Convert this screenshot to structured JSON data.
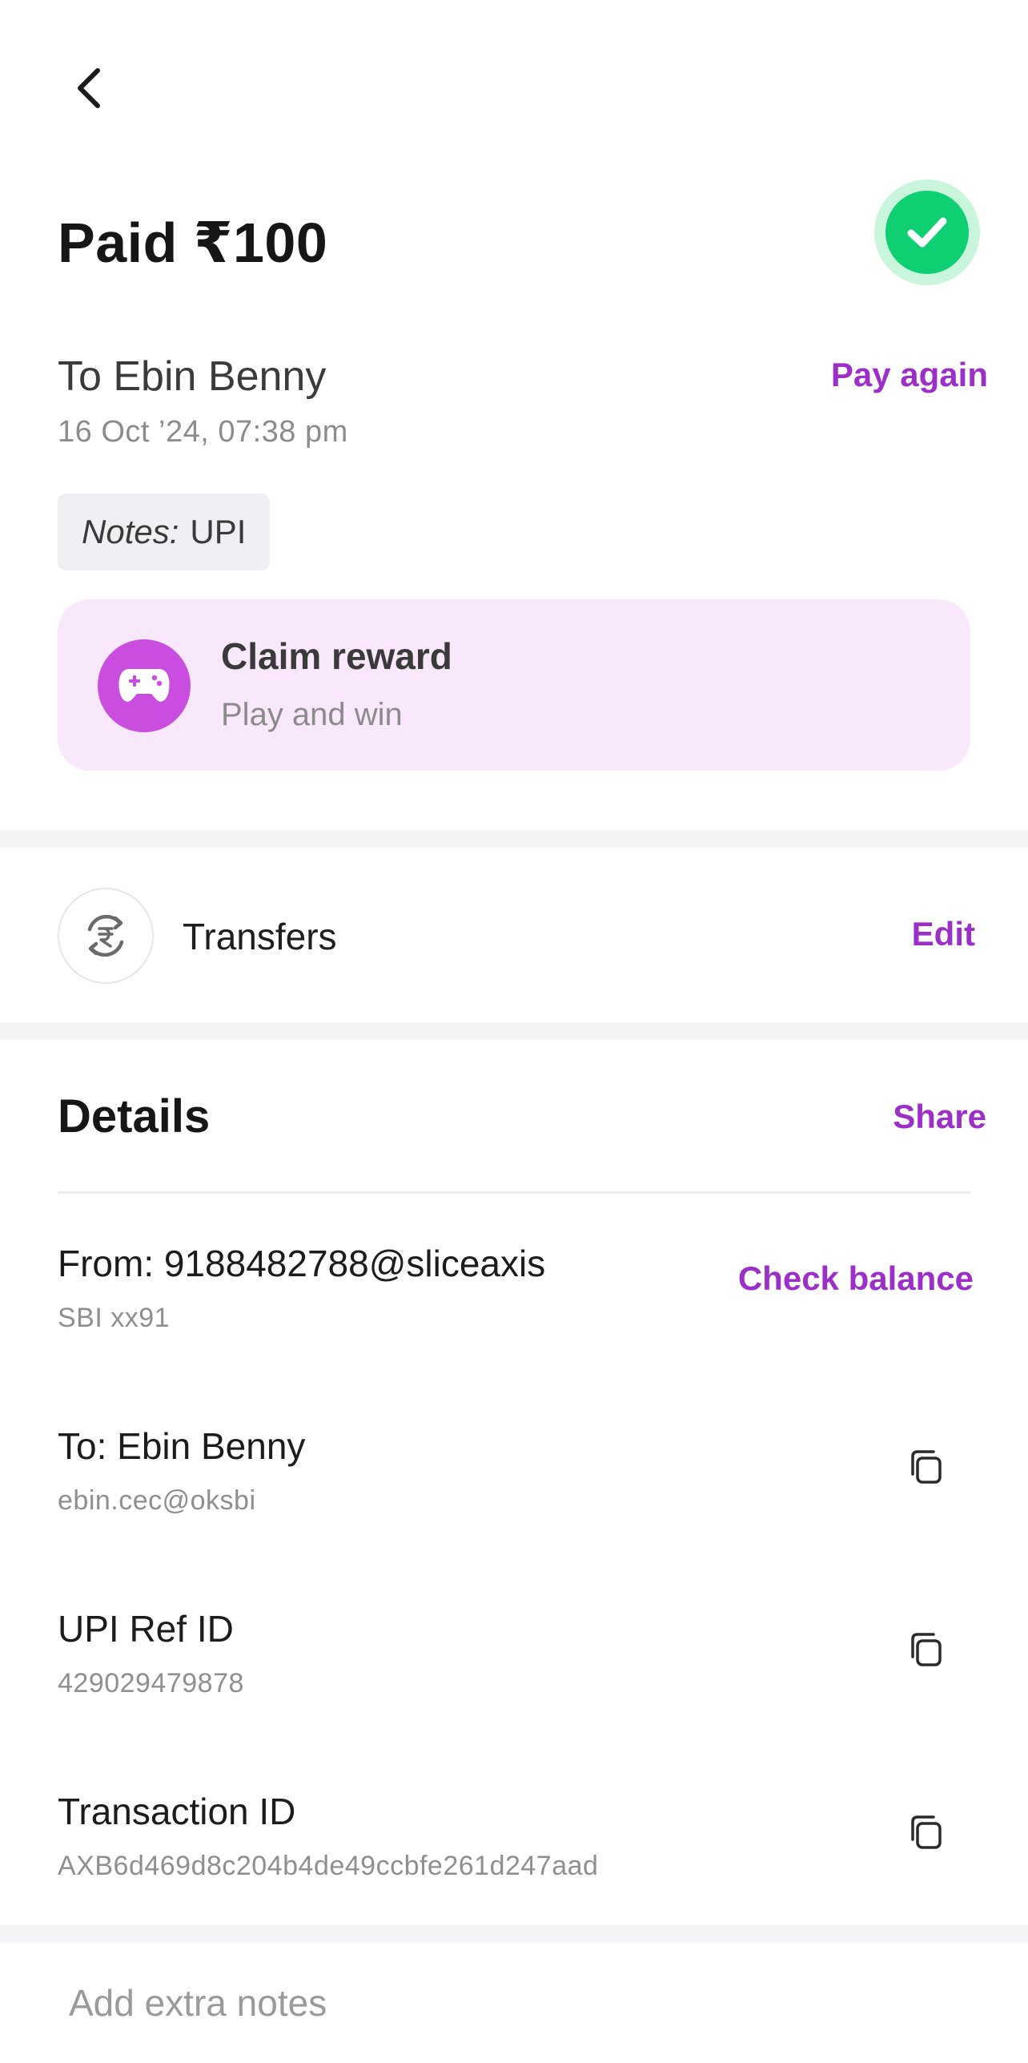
{
  "header": {
    "title": "Paid ₹100"
  },
  "summary": {
    "recipient": "To Ebin Benny",
    "pay_again_label": "Pay again",
    "datetime": "16 Oct ’24, 07:38 pm",
    "notes_label": "Notes:",
    "notes_value": "UPI"
  },
  "reward": {
    "title": "Claim reward",
    "subtitle": "Play and win"
  },
  "category": {
    "label": "Transfers",
    "edit_label": "Edit"
  },
  "details": {
    "title": "Details",
    "share_label": "Share",
    "from": {
      "main": "From: 9188482788@sliceaxis",
      "sub": "SBI xx91",
      "action_label": "Check balance"
    },
    "to": {
      "main": "To: Ebin Benny",
      "sub": "ebin.cec@oksbi"
    },
    "upi_ref": {
      "main": "UPI Ref ID",
      "sub": "429029479878"
    },
    "transaction": {
      "main": "Transaction ID",
      "sub": "AXB6d469d8c204b4de49ccbfe261d247aad"
    }
  },
  "extra_notes": {
    "placeholder": "Add extra notes",
    "value": ""
  },
  "colors": {
    "accent": "#9b2fc8",
    "success": "#0fcf73",
    "reward_bg": "#f9e8fb",
    "reward_icon": "#c94ee0"
  },
  "icons": {
    "back": "chevron-left-icon",
    "status": "check-circle-icon",
    "reward": "gamepad-icon",
    "category": "rupee-exchange-icon",
    "copy": "copy-icon"
  }
}
